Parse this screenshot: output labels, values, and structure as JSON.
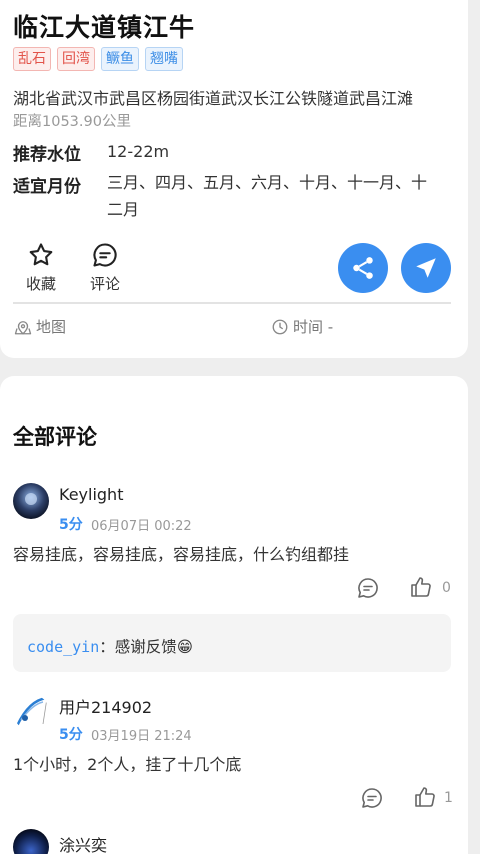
{
  "spot": {
    "title": "临江大道镇江牛",
    "tags": [
      {
        "label": "乱石",
        "color": "red"
      },
      {
        "label": "回湾",
        "color": "red"
      },
      {
        "label": "鳜鱼",
        "color": "blue"
      },
      {
        "label": "翘嘴",
        "color": "blue"
      }
    ],
    "address": "湖北省武汉市武昌区杨园街道武汉长江公铁隧道武昌江滩",
    "distance": "距离1053.90公里",
    "water_level_label": "推荐水位",
    "water_level_value": "12-22m",
    "months_label": "适宜月份",
    "months_value": "三月、四月、五月、六月、十月、十一月、十二月"
  },
  "actions": {
    "favorite": "收藏",
    "comment": "评论",
    "share_icon": "share-icon",
    "navigate_icon": "navigate-icon",
    "share_color": "#3a8ef0"
  },
  "meta": {
    "map": "地图",
    "time": "时间 -"
  },
  "comments_section": {
    "title": "全部评论",
    "comments": [
      {
        "user": "Keylight",
        "score": "5分",
        "date": "06月07日 00:22",
        "text": "容易挂底，容易挂底，容易挂底，什么钓组都挂",
        "likes": "0",
        "reply_user": "code_yin",
        "reply_sep": "：",
        "reply_text": "感谢反馈😁"
      },
      {
        "user": "用户214902",
        "score": "5分",
        "date": "03月19日 21:24",
        "text": "1个小时，2个人，挂了十几个底",
        "likes": "1"
      },
      {
        "user": "涂兴奕"
      }
    ]
  }
}
